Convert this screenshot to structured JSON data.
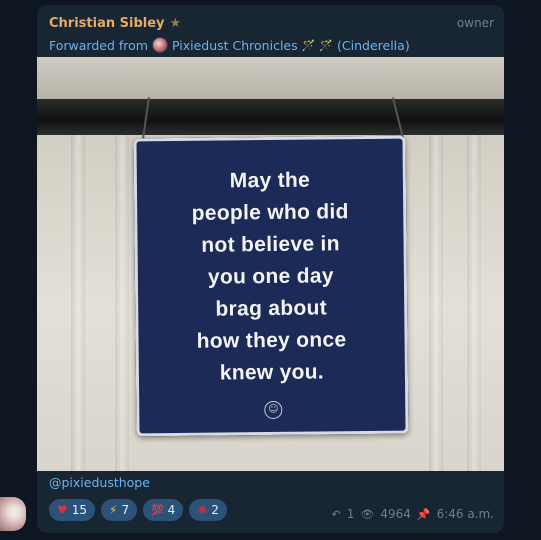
{
  "message": {
    "sender": "Christian Sibley",
    "role": "owner",
    "forwarded_prefix": "Forwarded from",
    "forwarded_channel": "Pixiedust Chronicles",
    "forwarded_suffix": "(Cinderella)",
    "wand_glyph": "🪄"
  },
  "image": {
    "sign_lines": [
      "May the",
      "people who did",
      "not believe in",
      "you one day",
      "brag about",
      "how they once",
      "knew you."
    ],
    "smiley": "☺"
  },
  "footer": {
    "handle": "@pixiedusthope",
    "reactions": [
      {
        "emoji": "♥",
        "icon": "heart-icon",
        "count": "15",
        "color": "#e0303a"
      },
      {
        "emoji": "⚡",
        "icon": "lightning-icon",
        "count": "7",
        "color": "#f2c12e"
      },
      {
        "emoji": "💯",
        "icon": "hundred-icon",
        "count": "4",
        "color": "#e0303a"
      },
      {
        "emoji": "✺",
        "icon": "burst-icon",
        "count": "2",
        "color": "#d52a3a"
      }
    ],
    "replies": "1",
    "views": "4964",
    "time": "6:46 a.m."
  }
}
